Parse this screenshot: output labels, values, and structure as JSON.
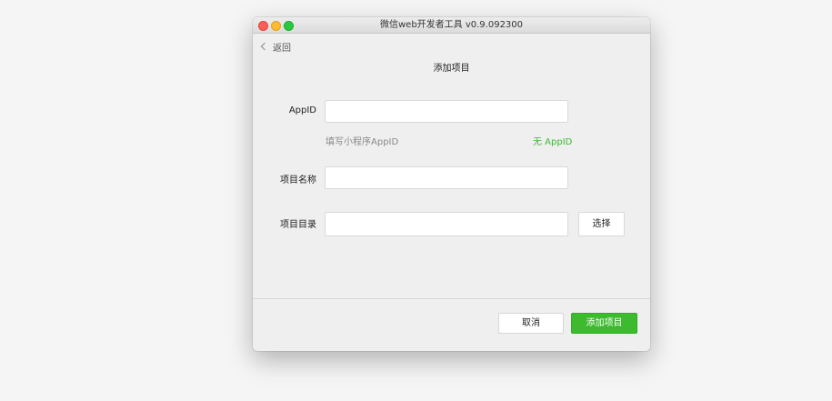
{
  "window": {
    "title": "微信web开发者工具 v0.9.092300"
  },
  "nav": {
    "back_label": "返回",
    "back_icon": "chevron-left-icon"
  },
  "page": {
    "title": "添加项目"
  },
  "form": {
    "appid": {
      "label": "AppID",
      "value": "",
      "hint": "填写小程序AppID",
      "no_appid_link": "无 AppID"
    },
    "project_name": {
      "label": "项目名称",
      "value": ""
    },
    "project_dir": {
      "label": "项目目录",
      "value": "",
      "select_label": "选择"
    }
  },
  "footer": {
    "cancel_label": "取消",
    "add_label": "添加项目"
  },
  "colors": {
    "accent": "#3cbb2e",
    "window_bg": "#efefef",
    "desktop_bg": "#f5f5f5"
  }
}
